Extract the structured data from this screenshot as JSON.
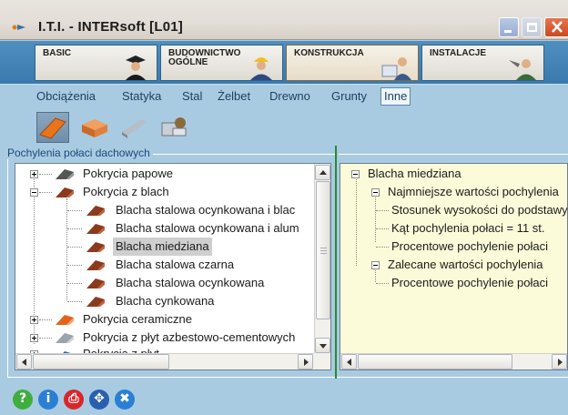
{
  "window": {
    "title": "I.T.I. - INTERsoft [L01]",
    "controls": {
      "minimize": "minimize-icon",
      "maximize": "maximize-icon",
      "close": "close-icon"
    }
  },
  "ribbon": {
    "tabs": [
      {
        "label": "BASIC",
        "icon": "graduate-icon"
      },
      {
        "label": "BUDOWNICTWO\nOGÓLNE",
        "icon": "builder-icon"
      },
      {
        "label": "KONSTRUKCJA",
        "icon": "engineer-icon",
        "active": true
      },
      {
        "label": "INSTALACJE",
        "icon": "plumber-icon"
      }
    ]
  },
  "categories": [
    "Obciążenia",
    "Statyka",
    "Stal",
    "Żelbet",
    "Drewno",
    "Grunty",
    "Inne"
  ],
  "selected_category": "Inne",
  "toolbar_icons": [
    "roof-icon",
    "bricks-icon",
    "steel-beam-icon",
    "tools-icon"
  ],
  "group_label": "Pochylenia połaci dachowych",
  "tree_left": {
    "items": [
      {
        "label": "Pokrycia papowe",
        "level": 0,
        "expander": "plus",
        "icon": "roof-dark-icon"
      },
      {
        "label": "Pokrycia z blach",
        "level": 0,
        "expander": "minus",
        "icon": "roof-brown-icon"
      },
      {
        "label": "Blacha stalowa ocynkowana i blac",
        "level": 1,
        "icon": "roof-brown-icon"
      },
      {
        "label": "Blacha stalowa ocynkowana i alum",
        "level": 1,
        "icon": "roof-brown-icon"
      },
      {
        "label": "Blacha miedziana",
        "level": 1,
        "icon": "roof-brown-icon",
        "selected": true
      },
      {
        "label": "Blacha stalowa czarna",
        "level": 1,
        "icon": "roof-brown-icon"
      },
      {
        "label": "Blacha stalowa ocynkowana",
        "level": 1,
        "icon": "roof-brown-icon"
      },
      {
        "label": "Blacha cynkowana",
        "level": 1,
        "icon": "roof-brown-icon"
      },
      {
        "label": "Pokrycia ceramiczne",
        "level": 0,
        "expander": "plus",
        "icon": "roof-orange-icon"
      },
      {
        "label": "Pokrycia z płyt azbestowo-cementowych",
        "level": 0,
        "expander": "plus",
        "icon": "roof-grey-icon"
      },
      {
        "label": "Pokrycia z płyt ...",
        "level": 0,
        "expander": "plus",
        "icon": "roof-blue-icon"
      }
    ]
  },
  "tree_right": {
    "items": [
      {
        "label": "Blacha miedziana",
        "level": 0,
        "expander": "minus"
      },
      {
        "label": "Najmniejsze wartości pochylenia",
        "level": 1,
        "expander": "minus"
      },
      {
        "label": "Stosunek wysokości do podstawy",
        "level": 2
      },
      {
        "label": "Kąt pochylenia połaci = 11 st.",
        "level": 2
      },
      {
        "label": "Procentowe pochylenie połaci",
        "level": 2
      },
      {
        "label": "Zalecane wartości pochylenia",
        "level": 1,
        "expander": "minus"
      },
      {
        "label": "Procentowe pochylenie połaci",
        "level": 2
      }
    ]
  },
  "bottom_buttons": [
    {
      "name": "help",
      "glyph": "?",
      "color": "#3fae3f",
      "icon": "help-icon"
    },
    {
      "name": "info",
      "glyph": "i",
      "color": "#2a7fd4",
      "icon": "info-icon"
    },
    {
      "name": "print",
      "glyph": "⎙",
      "color": "#d9262b",
      "icon": "print-icon"
    },
    {
      "name": "navigate",
      "glyph": "✥",
      "color": "#2a5fb0",
      "icon": "move-icon"
    },
    {
      "name": "settings",
      "glyph": "✖",
      "color": "#2a7fd4",
      "icon": "tools-icon"
    }
  ]
}
